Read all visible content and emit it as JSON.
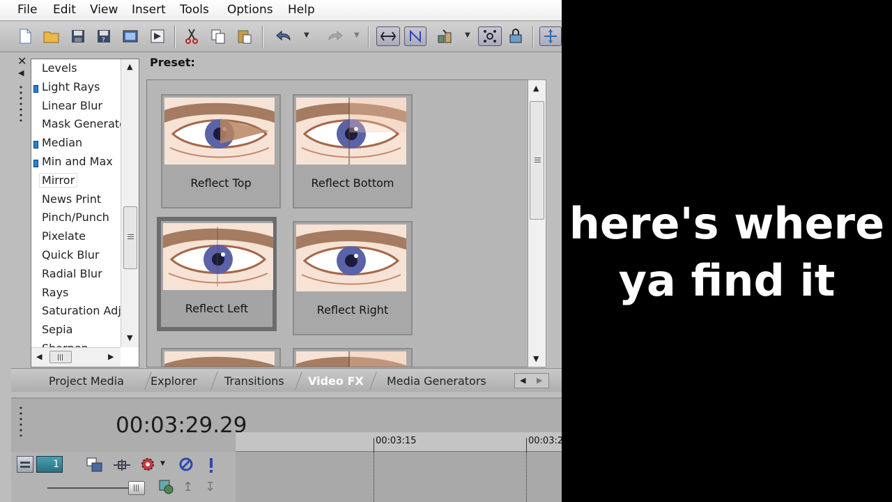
{
  "menu": [
    "File",
    "Edit",
    "View",
    "Insert",
    "Tools",
    "Options",
    "Help"
  ],
  "fx_list": {
    "items": [
      {
        "label": "Levels",
        "marked": false
      },
      {
        "label": "Light Rays",
        "marked": true
      },
      {
        "label": "Linear Blur",
        "marked": false
      },
      {
        "label": "Mask Generato",
        "marked": false
      },
      {
        "label": "Median",
        "marked": true
      },
      {
        "label": "Min and Max",
        "marked": true
      },
      {
        "label": "Mirror",
        "marked": false,
        "selected": true
      },
      {
        "label": "News Print",
        "marked": false
      },
      {
        "label": "Pinch/Punch",
        "marked": false
      },
      {
        "label": "Pixelate",
        "marked": false
      },
      {
        "label": "Quick Blur",
        "marked": false
      },
      {
        "label": "Radial Blur",
        "marked": false
      },
      {
        "label": "Rays",
        "marked": false
      },
      {
        "label": "Saturation Adju",
        "marked": false
      },
      {
        "label": "Sepia",
        "marked": false
      },
      {
        "label": "Sharpen",
        "marked": false
      }
    ]
  },
  "preset": {
    "label": "Preset:",
    "tiles": [
      {
        "label": "Reflect Top",
        "selected": false
      },
      {
        "label": "Reflect Bottom",
        "selected": false
      },
      {
        "label": "Reflect Left",
        "selected": true
      },
      {
        "label": "Reflect Right",
        "selected": false
      }
    ]
  },
  "tabs": [
    {
      "label": "Project Media",
      "active": false
    },
    {
      "label": "Explorer",
      "active": false
    },
    {
      "label": "Transitions",
      "active": false
    },
    {
      "label": "Video FX",
      "active": true
    },
    {
      "label": "Media Generators",
      "active": false
    }
  ],
  "timeline": {
    "timecode": "00:03:29.29",
    "track_number": "1",
    "ruler_labels": [
      "00:03:15",
      "00:03:2"
    ]
  },
  "caption": "here's where\nya find it",
  "colors": {
    "app_bg": "#bdbdbd",
    "active_tab_text": "#ffffff",
    "marker_blue": "#2a7fd4",
    "caption_bg": "#000000",
    "caption_text": "#ffffff"
  }
}
